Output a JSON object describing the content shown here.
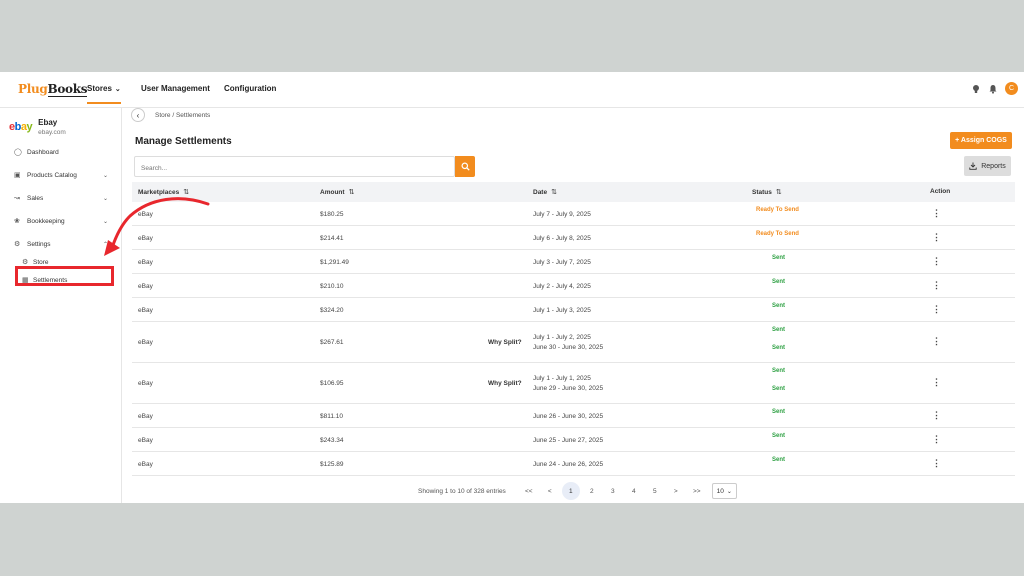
{
  "topnav": {
    "logo_part1": "Plug",
    "logo_part2": "Books",
    "stores": "Stores",
    "user_management": "User Management",
    "configuration": "Configuration",
    "avatar_initial": "C"
  },
  "sidebar": {
    "store_name": "Ebay",
    "store_domain": "ebay.com",
    "logo_letters": [
      "e",
      "b",
      "a",
      "y"
    ],
    "items": [
      {
        "label": "Dashboard",
        "icon": "dashboard-icon"
      },
      {
        "label": "Products Catalog",
        "icon": "box-icon"
      },
      {
        "label": "Sales",
        "icon": "chart-icon"
      },
      {
        "label": "Bookkeeping",
        "icon": "book-icon"
      },
      {
        "label": "Settings",
        "icon": "gear-icon"
      }
    ],
    "sub_items": [
      {
        "label": "Store",
        "icon": "gear-icon"
      },
      {
        "label": "Settlements",
        "icon": "calculator-icon"
      }
    ]
  },
  "breadcrumb": "Store  /  Settlements",
  "page_title": "Manage Settlements",
  "buttons": {
    "assign": "+ Assign COGS",
    "reports": "Reports"
  },
  "search": {
    "placeholder": "Search..."
  },
  "table": {
    "headers": [
      "Marketplaces",
      "Amount",
      "Date",
      "Status",
      "Action"
    ],
    "rows": [
      {
        "marketplace": "eBay",
        "amount": "$180.25",
        "dates": [
          "July 7 - July 9, 2025"
        ],
        "statuses": [
          "Ready To Send"
        ],
        "split": ""
      },
      {
        "marketplace": "eBay",
        "amount": "$214.41",
        "dates": [
          "July 6 - July 8, 2025"
        ],
        "statuses": [
          "Ready To Send"
        ],
        "split": ""
      },
      {
        "marketplace": "eBay",
        "amount": "$1,291.49",
        "dates": [
          "July 3 - July 7, 2025"
        ],
        "statuses": [
          "Sent"
        ],
        "split": ""
      },
      {
        "marketplace": "eBay",
        "amount": "$210.10",
        "dates": [
          "July 2 - July 4, 2025"
        ],
        "statuses": [
          "Sent"
        ],
        "split": ""
      },
      {
        "marketplace": "eBay",
        "amount": "$324.20",
        "dates": [
          "July 1 - July 3, 2025"
        ],
        "statuses": [
          "Sent"
        ],
        "split": ""
      },
      {
        "marketplace": "eBay",
        "amount": "$267.61",
        "dates": [
          "July 1 - July 2, 2025",
          "June 30 - June 30, 2025"
        ],
        "statuses": [
          "Sent",
          "Sent"
        ],
        "split": "Why Split?"
      },
      {
        "marketplace": "eBay",
        "amount": "$106.95",
        "dates": [
          "July 1 - July 1, 2025",
          "June 29 - June 30, 2025"
        ],
        "statuses": [
          "Sent",
          "Sent"
        ],
        "split": "Why Split?"
      },
      {
        "marketplace": "eBay",
        "amount": "$811.10",
        "dates": [
          "June 26 - June 30, 2025"
        ],
        "statuses": [
          "Sent"
        ],
        "split": ""
      },
      {
        "marketplace": "eBay",
        "amount": "$243.34",
        "dates": [
          "June 25 - June 27, 2025"
        ],
        "statuses": [
          "Sent"
        ],
        "split": ""
      },
      {
        "marketplace": "eBay",
        "amount": "$125.89",
        "dates": [
          "June 24 - June 26, 2025"
        ],
        "statuses": [
          "Sent"
        ],
        "split": ""
      }
    ]
  },
  "pagination": {
    "info": "Showing 1 to 10 of 328 entries",
    "first": "<<",
    "prev": "<",
    "pages": [
      "1",
      "2",
      "3",
      "4",
      "5"
    ],
    "next": ">",
    "last": ">>",
    "page_size": "10"
  },
  "colors": {
    "accent": "#f28c1e",
    "sent": "#2ea043",
    "highlight": "#e8272d"
  }
}
